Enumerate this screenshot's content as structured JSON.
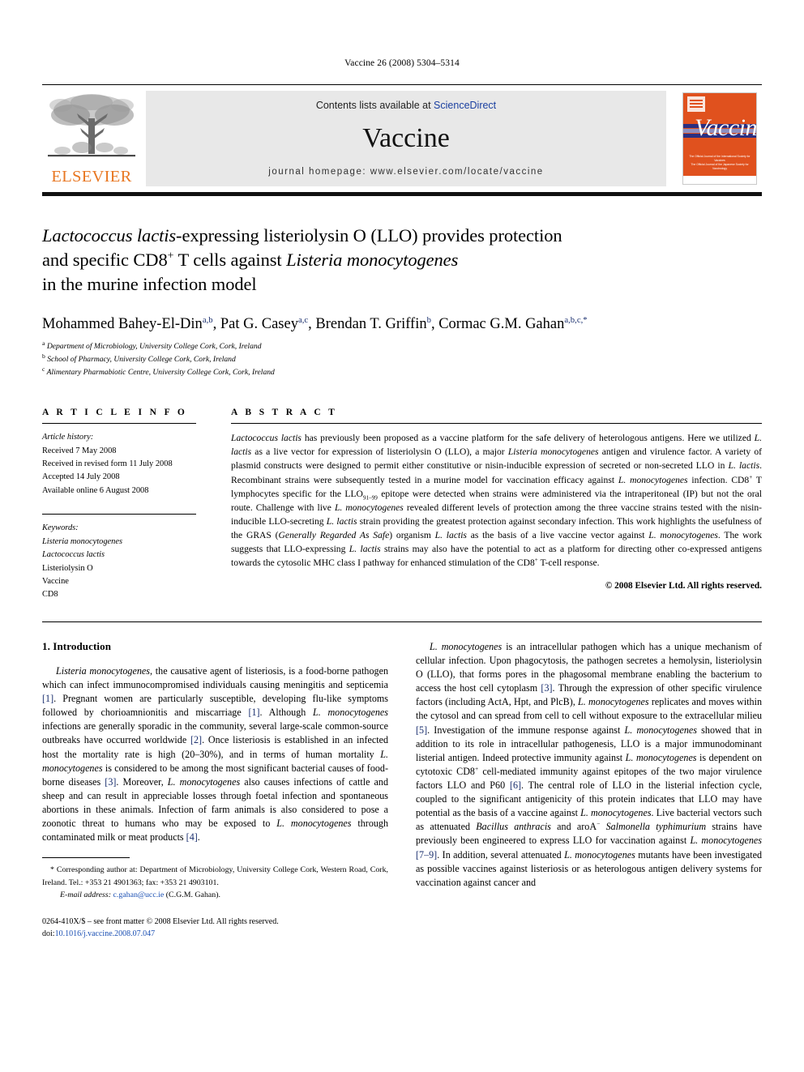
{
  "running_head": "Vaccine 26 (2008) 5304–5314",
  "header": {
    "contents_prefix": "Contents lists available at ",
    "sciencedirect": "ScienceDirect",
    "journal_name": "Vaccine",
    "homepage": "journal homepage: www.elsevier.com/locate/vaccine",
    "publisher_wordmark": "ELSEVIER",
    "publisher_color": "#E87722",
    "link_color": "#1a3fa0",
    "panel_color": "#e8e8e8",
    "cover": {
      "title": "Vaccine",
      "background_color": "#E0511E",
      "band_color": "#2b2f80",
      "footer_line1": "The Official Journal of the International Society for Vaccines",
      "footer_line2": "The Official Journal of the Japanese Society for Vaccinology"
    }
  },
  "article": {
    "title_line1_a": "Lactococcus lactis",
    "title_line1_b": "-expressing listeriolysin O (LLO) provides protection",
    "title_line2_a": "and specific CD8",
    "title_line2_sup": "+",
    "title_line2_b": " T cells against ",
    "title_line2_italic": "Listeria monocytogenes",
    "title_line3": "in the murine infection model",
    "authors": [
      {
        "name": "Mohammed Bahey-El-Din",
        "marks": "a,b",
        "sep": ", "
      },
      {
        "name": "Pat G. Casey",
        "marks": "a,c",
        "sep": ", "
      },
      {
        "name": "Brendan T. Griffin",
        "marks": "b",
        "sep": ", "
      },
      {
        "name": "Cormac G.M. Gahan",
        "marks": "a,b,c,*",
        "sep": ""
      }
    ],
    "affiliations": [
      {
        "mark": "a",
        "text": "Department of Microbiology, University College Cork, Cork, Ireland"
      },
      {
        "mark": "b",
        "text": "School of Pharmacy, University College Cork, Cork, Ireland"
      },
      {
        "mark": "c",
        "text": "Alimentary Pharmabiotic Centre, University College Cork, Cork, Ireland"
      }
    ]
  },
  "article_info": {
    "heading": "A R T I C L E   I N F O",
    "history_title": "Article history:",
    "history": [
      "Received 7 May 2008",
      "Received in revised form 11 July 2008",
      "Accepted 14 July 2008",
      "Available online 6 August 2008"
    ],
    "keywords_title": "Keywords:",
    "keywords": [
      {
        "text": "Listeria monocytogenes",
        "italic": true
      },
      {
        "text": "Lactococcus lactis",
        "italic": true
      },
      {
        "text": "Listeriolysin O",
        "italic": false
      },
      {
        "text": "Vaccine",
        "italic": false
      },
      {
        "text": "CD8",
        "italic": false
      }
    ]
  },
  "abstract": {
    "heading": "A B S T R A C T",
    "copyright": "© 2008 Elsevier Ltd. All rights reserved."
  },
  "body": {
    "section_heading": "1. Introduction",
    "left_paragraph_citations": [
      "[1]",
      "[1]",
      "[2]",
      "[3]",
      "[4]"
    ],
    "right_paragraph_citations": [
      "[3]",
      "[5]",
      "[6]",
      "[7–9]"
    ]
  },
  "footnote": {
    "star": "*",
    "corresponding": "Corresponding author at: Department of Microbiology, University College Cork, Western Road, Cork, Ireland. Tel.: +353 21 4901363; fax: +353 21 4903101.",
    "email_label": "E-mail address:",
    "email": "c.gahan@ucc.ie",
    "email_owner": "(C.G.M. Gahan).",
    "imprint_line1": "0264-410X/$ – see front matter © 2008 Elsevier Ltd. All rights reserved.",
    "doi_label": "doi:",
    "doi": "10.1016/j.vaccine.2008.07.047"
  }
}
